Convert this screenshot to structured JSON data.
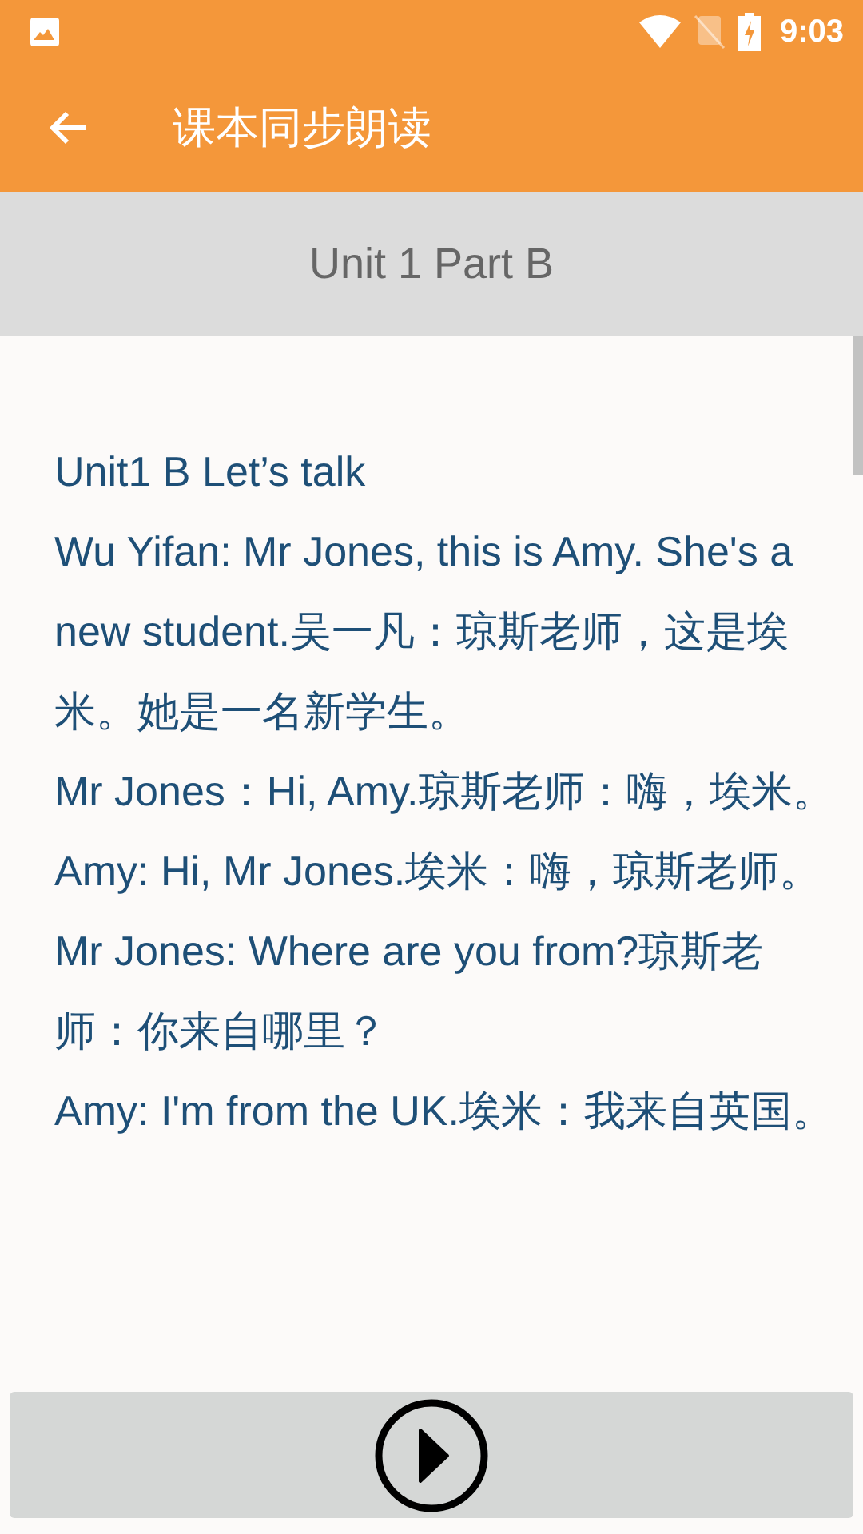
{
  "status_bar": {
    "time": "9:03"
  },
  "app_bar": {
    "title": "课本同步朗读"
  },
  "unit_header": {
    "title": "Unit 1  Part B"
  },
  "paragraphs": [
    "Unit1 B Let’s talk",
    "Wu Yifan: Mr Jones, this is Amy. She's a new student.吴一凡：琼斯老师，这是埃米。她是一名新学生。",
    "Mr Jones：Hi, Amy.琼斯老师：嗨，埃米。",
    "Amy: Hi, Mr Jones.埃米：嗨，琼斯老师。",
    "Mr Jones: Where are you from?琼斯老师：你来自哪里？",
    "Amy: I'm from the UK.埃米：我来自英国。"
  ]
}
